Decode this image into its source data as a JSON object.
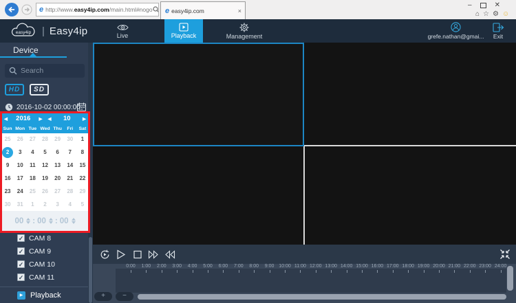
{
  "browser": {
    "url_prefix": "http://www.",
    "url_host": "easy4ip.com",
    "url_path": "/main.html#nogo",
    "tab_title": "easy4ip.com",
    "tab_close_icon": "×",
    "win_min_icon": "–",
    "win_close_icon": "✕",
    "home_icon": "⌂",
    "star_icon": "☆",
    "gear_icon": "⚙",
    "smiley_icon": "☺"
  },
  "header": {
    "logo_text": "easy4ip",
    "logo_divider": "|",
    "app_title": "Easy4ip",
    "nav_live": "Live",
    "nav_playback": "Playback",
    "nav_management": "Management",
    "user_email": "grefe.nathan@gmai...",
    "exit_label": "Exit"
  },
  "sidebar": {
    "tab_label": "Device",
    "search_placeholder": "Search",
    "hd_label": "HD",
    "sd_label": "SD",
    "datetime": "2016-10-02 00:00:00",
    "calendar": {
      "year": "2016",
      "month": "10",
      "prev_icon": "◀",
      "next_icon": "▶",
      "day_names": [
        "Sun",
        "Mon",
        "Tue",
        "Wed",
        "Thu",
        "Fri",
        "Sat"
      ],
      "days": [
        {
          "d": "25",
          "state": "muted"
        },
        {
          "d": "26",
          "state": "muted"
        },
        {
          "d": "27",
          "state": "muted"
        },
        {
          "d": "28",
          "state": "muted"
        },
        {
          "d": "29",
          "state": "muted"
        },
        {
          "d": "30",
          "state": "muted"
        },
        {
          "d": "1",
          "state": "normal"
        },
        {
          "d": "2",
          "state": "selected"
        },
        {
          "d": "3",
          "state": "normal"
        },
        {
          "d": "4",
          "state": "normal"
        },
        {
          "d": "5",
          "state": "normal"
        },
        {
          "d": "6",
          "state": "normal"
        },
        {
          "d": "7",
          "state": "normal"
        },
        {
          "d": "8",
          "state": "normal"
        },
        {
          "d": "9",
          "state": "normal"
        },
        {
          "d": "10",
          "state": "normal"
        },
        {
          "d": "11",
          "state": "normal"
        },
        {
          "d": "12",
          "state": "normal"
        },
        {
          "d": "13",
          "state": "normal"
        },
        {
          "d": "14",
          "state": "normal"
        },
        {
          "d": "15",
          "state": "normal"
        },
        {
          "d": "16",
          "state": "normal"
        },
        {
          "d": "17",
          "state": "normal"
        },
        {
          "d": "18",
          "state": "normal"
        },
        {
          "d": "19",
          "state": "normal"
        },
        {
          "d": "20",
          "state": "normal"
        },
        {
          "d": "21",
          "state": "normal"
        },
        {
          "d": "22",
          "state": "normal"
        },
        {
          "d": "23",
          "state": "normal"
        },
        {
          "d": "24",
          "state": "normal"
        },
        {
          "d": "25",
          "state": "muted"
        },
        {
          "d": "26",
          "state": "muted"
        },
        {
          "d": "27",
          "state": "muted"
        },
        {
          "d": "28",
          "state": "muted"
        },
        {
          "d": "29",
          "state": "muted"
        },
        {
          "d": "30",
          "state": "muted"
        },
        {
          "d": "31",
          "state": "muted"
        },
        {
          "d": "1",
          "state": "muted"
        },
        {
          "d": "2",
          "state": "muted"
        },
        {
          "d": "3",
          "state": "muted"
        },
        {
          "d": "4",
          "state": "muted"
        },
        {
          "d": "5",
          "state": "muted"
        }
      ],
      "hours": "00",
      "minutes": "00",
      "seconds": "00",
      "time_separator": ":"
    },
    "check_icon": "✓",
    "cameras": [
      {
        "label": "CAM 8",
        "checked": true
      },
      {
        "label": "CAM 9",
        "checked": true
      },
      {
        "label": "CAM 10",
        "checked": true
      },
      {
        "label": "CAM 11",
        "checked": true
      }
    ],
    "playback_label": "Playback",
    "playback_icon": "▶"
  },
  "timeline": {
    "labels": [
      "0:00",
      "1:00",
      "2:00",
      "3:00",
      "4:00",
      "5:00",
      "6:00",
      "7:00",
      "8:00",
      "9:00",
      "10:00",
      "11:00",
      "12:00",
      "13:00",
      "14:00",
      "15:00",
      "16:00",
      "17:00",
      "18:00",
      "19:00",
      "20:00",
      "21:00",
      "22:00",
      "23:00",
      "24:00"
    ],
    "zoom_in_label": "+",
    "zoom_out_label": "−"
  },
  "colors": {
    "accent": "#1e9fdd",
    "selected_day": "#2aa8e2",
    "annotation": "#ed1c24",
    "header_bg": "#1e2c3c",
    "sidebar_bg": "#2f3d52"
  }
}
